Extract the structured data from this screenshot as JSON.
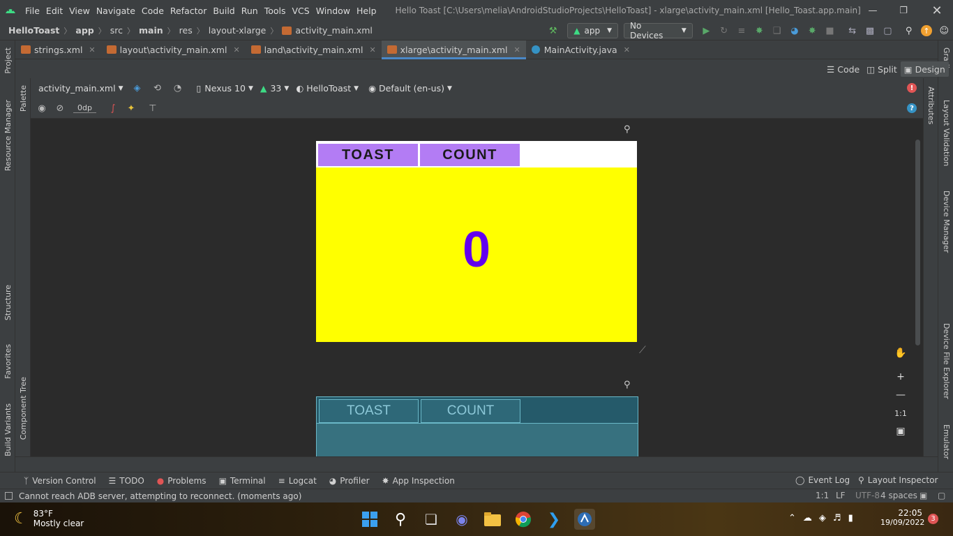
{
  "window": {
    "title": "Hello Toast [C:\\Users\\melia\\AndroidStudioProjects\\HelloToast] - xlarge\\activity_main.xml [Hello_Toast.app.main]",
    "menu": [
      "File",
      "Edit",
      "View",
      "Navigate",
      "Code",
      "Refactor",
      "Build",
      "Run",
      "Tools",
      "VCS",
      "Window",
      "Help"
    ]
  },
  "breadcrumb": [
    "HelloToast",
    "app",
    "src",
    "main",
    "res",
    "layout-xlarge",
    "activity_main.xml"
  ],
  "run": {
    "config": "app",
    "device": "No Devices"
  },
  "tabs": [
    {
      "label": "strings.xml",
      "active": false
    },
    {
      "label": "layout\\activity_main.xml",
      "active": false
    },
    {
      "label": "land\\activity_main.xml",
      "active": false
    },
    {
      "label": "xlarge\\activity_main.xml",
      "active": true
    },
    {
      "label": "MainActivity.java",
      "active": false
    }
  ],
  "left_tools": [
    "Project",
    "Resource Manager",
    "Structure",
    "Favorites",
    "Build Variants"
  ],
  "right_tools": [
    "Gradle",
    "Layout Validation",
    "Device Manager",
    "Device File Explorer",
    "Emulator"
  ],
  "palette_tools": [
    "Palette",
    "Component Tree"
  ],
  "attr_tool": "Attributes",
  "view_modes": {
    "code": "Code",
    "split": "Split",
    "design": "Design"
  },
  "design_toolbar": {
    "file": "activity_main.xml",
    "device": "Nexus 10",
    "api": "33",
    "theme": "HelloToast",
    "locale": "Default (en-us)",
    "margin": "0dp"
  },
  "preview": {
    "toast_label": "TOAST",
    "count_label": "COUNT",
    "count_value": "0",
    "colors": {
      "button_bg": "#b37cf4",
      "main_bg": "#ffff00",
      "count_text": "#6200ee"
    }
  },
  "blueprint": {
    "toast_label": "TOAST",
    "count_label": "COUNT"
  },
  "zoom": {
    "fit_label": "1:1"
  },
  "bottom_tools": {
    "left": [
      "Version Control",
      "TODO",
      "Problems",
      "Terminal",
      "Logcat",
      "Profiler",
      "App Inspection"
    ],
    "right": [
      "Event Log",
      "Layout Inspector"
    ]
  },
  "status": {
    "message": "Cannot reach ADB server, attempting to reconnect. (moments ago)",
    "position": "1:1",
    "line_sep": "LF",
    "encoding": "UTF-8",
    "indent": "4 spaces"
  },
  "taskbar": {
    "weather_temp": "83°F",
    "weather_text": "Mostly clear",
    "time": "22:05",
    "date": "19/09/2022",
    "notif_count": "3"
  }
}
